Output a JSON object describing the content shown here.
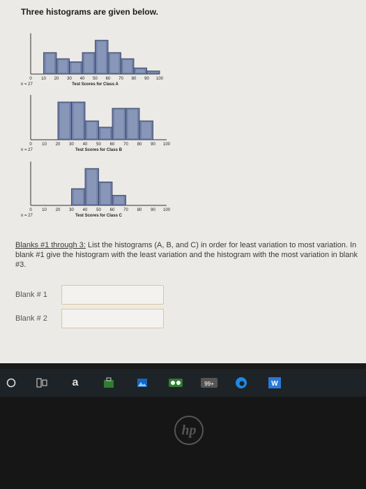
{
  "question": {
    "title": "Three histograms are given below."
  },
  "histograms": [
    {
      "ticks": [
        "0",
        "10",
        "20",
        "30",
        "40",
        "50",
        "60",
        "70",
        "80",
        "90",
        "100"
      ],
      "n_label": "n = 27",
      "caption": "Test Scores for Class A",
      "bar_heights": [
        0,
        14,
        10,
        8,
        14,
        22,
        14,
        10,
        4,
        2,
        0
      ]
    },
    {
      "ticks": [
        "0",
        "10",
        "20",
        "30",
        "40",
        "50",
        "60",
        "70",
        "80",
        "90",
        "100"
      ],
      "n_label": "n = 27",
      "caption": "Test Scores for Class B",
      "bar_heights": [
        0,
        0,
        12,
        12,
        6,
        4,
        10,
        10,
        6,
        0,
        0
      ]
    },
    {
      "ticks": [
        "0",
        "10",
        "20",
        "30",
        "40",
        "50",
        "60",
        "70",
        "80",
        "90",
        "100"
      ],
      "n_label": "n = 27",
      "caption": "Test Scores for Class C",
      "bar_heights": [
        0,
        0,
        0,
        5,
        11,
        7,
        3,
        0,
        0,
        0,
        0
      ]
    }
  ],
  "prompt": {
    "lead": "Blanks #1 through 3:",
    "text": " List the histograms (A, B, and C) in order for least variation to most variation. In blank #1 give the histogram with the least variation and the histogram with the most variation in blank #3."
  },
  "blanks": [
    {
      "label": "Blank # 1",
      "value": ""
    },
    {
      "label": "Blank # 2",
      "value": ""
    }
  ],
  "taskbar": {
    "badge": "99+",
    "amazon": "a",
    "word": "W",
    "colors": {
      "edge": "#1e88e5",
      "word": "#2b78d8",
      "store": "#2e7d32",
      "photos": "#1565c0"
    }
  },
  "hp_logo": "hp"
}
